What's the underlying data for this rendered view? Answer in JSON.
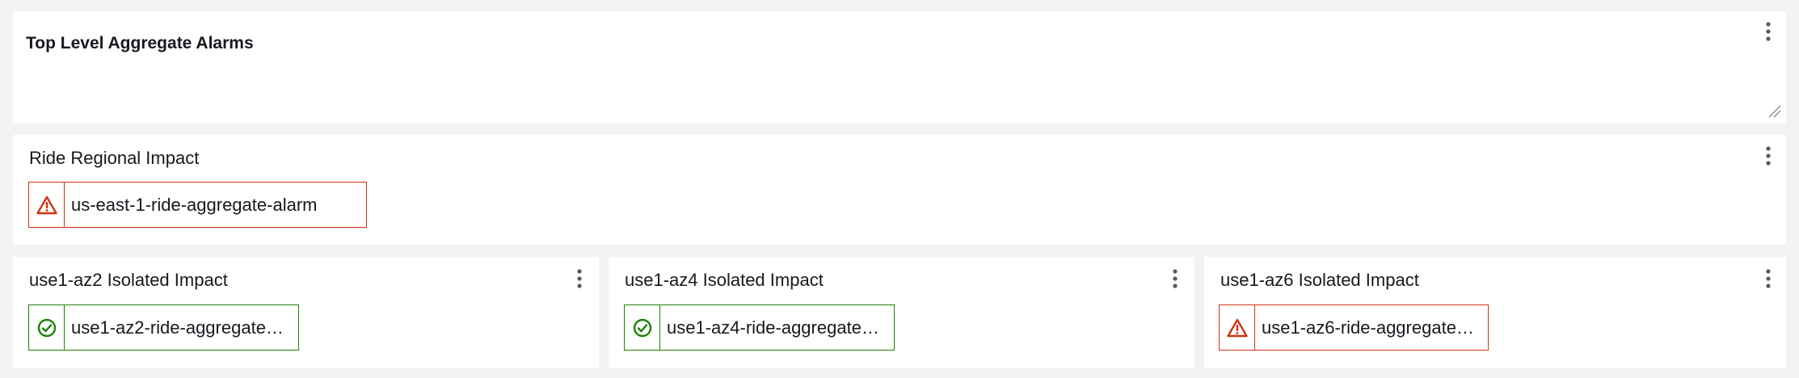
{
  "text_widget": {
    "title": "Top Level Aggregate Alarms",
    "menu_icon": "vertical-ellipsis-icon",
    "resize_icon": "resize-handle-icon"
  },
  "regional_widget": {
    "title": "Ride Regional Impact",
    "menu_icon": "vertical-ellipsis-icon",
    "alarm": {
      "name": "us-east-1-ride-aggregate-alarm",
      "state": "ALARM",
      "icon": "warning-triangle-icon"
    }
  },
  "az_widgets": [
    {
      "title": "use1-az2 Isolated Impact",
      "menu_icon": "vertical-ellipsis-icon",
      "alarm": {
        "name": "use1-az2-ride-aggregate…",
        "state": "OK",
        "icon": "check-circle-icon"
      }
    },
    {
      "title": "use1-az4 Isolated Impact",
      "menu_icon": "vertical-ellipsis-icon",
      "alarm": {
        "name": "use1-az4-ride-aggregate…",
        "state": "OK",
        "icon": "check-circle-icon"
      }
    },
    {
      "title": "use1-az6 Isolated Impact",
      "menu_icon": "vertical-ellipsis-icon",
      "alarm": {
        "name": "use1-az6-ride-aggregate…",
        "state": "ALARM",
        "icon": "warning-triangle-icon"
      }
    }
  ],
  "colors": {
    "background": "#f2f3f3",
    "alarm": "#d13212",
    "ok": "#1d8102",
    "text": "#16191f"
  }
}
